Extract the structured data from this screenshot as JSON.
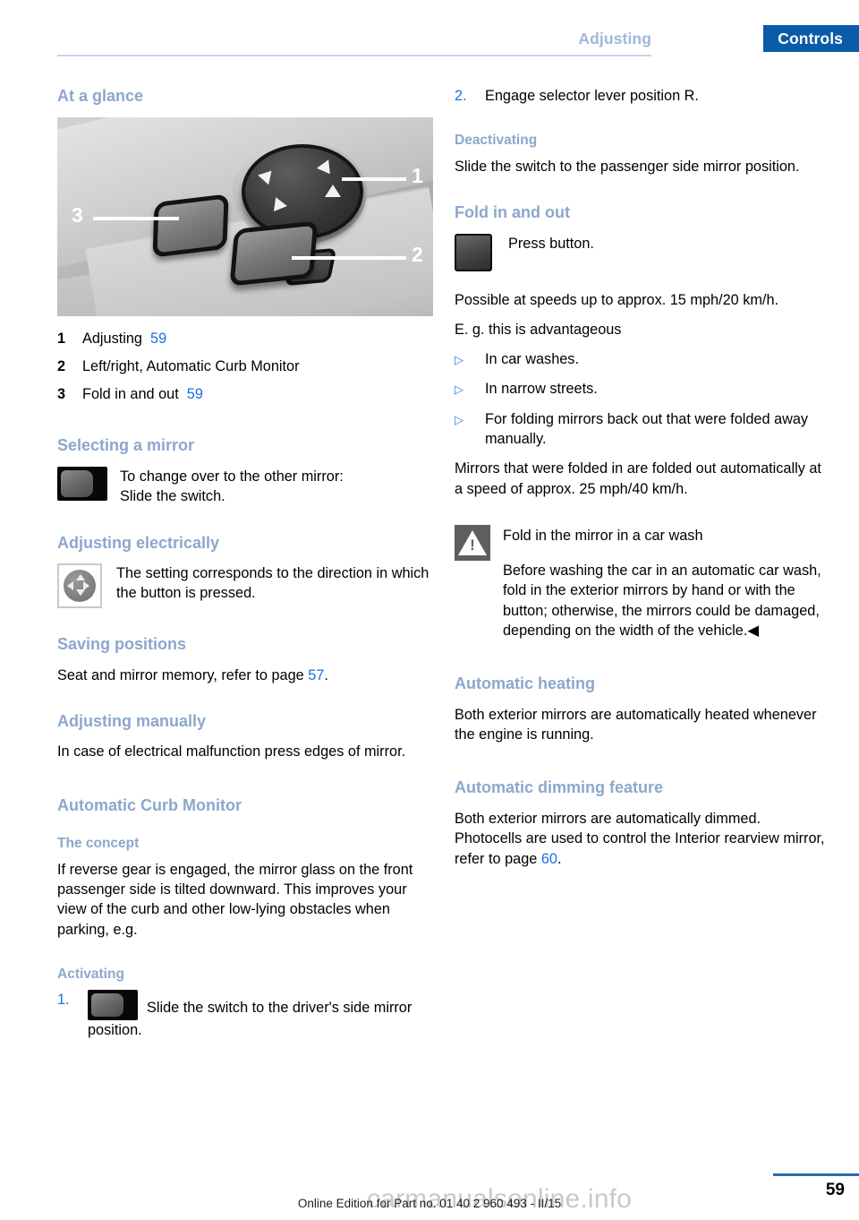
{
  "header": {
    "chapter": "Adjusting",
    "section": "Controls",
    "accent_color": "#0b5ca8",
    "chapter_color": "#9fb8d8"
  },
  "left_column": {
    "at_a_glance_heading": "At a glance",
    "figure": {
      "callouts": [
        "1",
        "2",
        "3"
      ]
    },
    "legend": [
      {
        "num": "1",
        "text": "Adjusting",
        "page": "59"
      },
      {
        "num": "2",
        "text": "Left/right, Automatic Curb Monitor",
        "page": ""
      },
      {
        "num": "3",
        "text": "Fold in and out",
        "page": "59"
      }
    ],
    "selecting_mirror": {
      "heading": "Selecting a mirror",
      "line1": "To change over to the other mirror:",
      "line2": "Slide the switch."
    },
    "adjusting_electrically": {
      "heading": "Adjusting electrically",
      "text": "The setting corresponds to the direction in which the button is pressed."
    },
    "saving_positions": {
      "heading": "Saving positions",
      "text_before": "Seat and mirror memory, refer to page ",
      "page": "57",
      "text_after": "."
    },
    "adjusting_manually": {
      "heading": "Adjusting manually",
      "text": "In case of electrical malfunction press edges of mirror."
    },
    "automatic_curb_monitor": {
      "heading": "Automatic Curb Monitor",
      "concept_heading": "The concept",
      "concept_text": "If reverse gear is engaged, the mirror glass on the front passenger side is tilted downward. This improves your view of the curb and other low-lying obstacles when parking, e.g.",
      "activating_heading": "Activating",
      "step1_num": "1.",
      "step1_text": "Slide the switch to the driver's side mirror position."
    }
  },
  "right_column": {
    "step2_num": "2.",
    "step2_text": "Engage selector lever position R.",
    "deactivating": {
      "heading": "Deactivating",
      "text": "Slide the switch to the passenger side mirror position."
    },
    "fold_in_and_out": {
      "heading": "Fold in and out",
      "press_button_text": "Press button.",
      "speed_text": "Possible at speeds up to approx. 15 mph/20 km/h.",
      "advantageous_text": "E. g. this is advantageous",
      "bullet_glyph": "▷",
      "bullets": [
        "In car washes.",
        "In narrow streets.",
        "For folding mirrors back out that were folded away manually."
      ],
      "auto_fold_text": "Mirrors that were folded in are folded out automatically at a speed of approx. 25 mph/40 km/h."
    },
    "warning": {
      "title": "Fold in the mirror in a car wash",
      "body": "Before washing the car in an automatic car wash, fold in the exterior mirrors by hand or with the button; otherwise, the mirrors could be damaged, depending on the width of the vehicle.◀"
    },
    "automatic_heating": {
      "heading": "Automatic heating",
      "text": "Both exterior mirrors are automatically heated whenever the engine is running."
    },
    "automatic_dimming": {
      "heading": "Automatic dimming feature",
      "text_before": "Both exterior mirrors are automatically dimmed. Photocells are used to control the Interior rearview mirror, refer to page ",
      "page": "60",
      "text_after": "."
    }
  },
  "footer": {
    "edition": "Online Edition for Part no. 01 40 2 960 493 - II/15",
    "page_number": "59",
    "watermark": "carmanualsonline.info"
  }
}
